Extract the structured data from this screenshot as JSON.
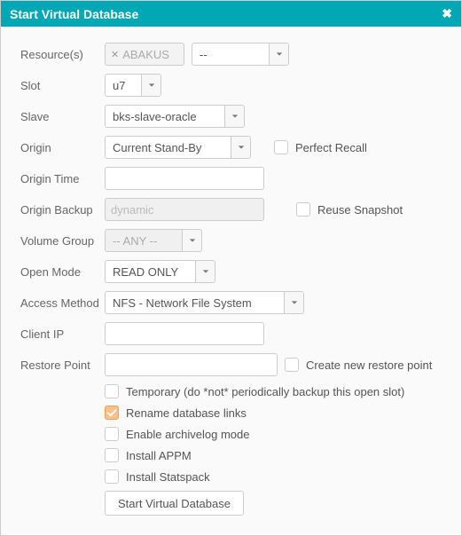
{
  "title": "Start Virtual Database",
  "labels": {
    "resources": "Resource(s)",
    "slot": "Slot",
    "slave": "Slave",
    "origin": "Origin",
    "origin_time": "Origin Time",
    "origin_backup": "Origin Backup",
    "volume_group": "Volume Group",
    "open_mode": "Open Mode",
    "access_method": "Access Method",
    "client_ip": "Client IP",
    "restore_point": "Restore Point"
  },
  "values": {
    "resource_tag": "ABAKUS",
    "resource_select": "--",
    "slot": "u7",
    "slave": "bks-slave-oracle",
    "origin": "Current Stand-By",
    "origin_time": "",
    "origin_backup_placeholder": "dynamic",
    "volume_group": "-- ANY --",
    "open_mode": "READ ONLY",
    "access_method": "NFS - Network File System",
    "client_ip": "",
    "restore_point": ""
  },
  "checkboxes": {
    "perfect_recall": {
      "label": "Perfect Recall",
      "checked": false
    },
    "reuse_snapshot": {
      "label": "Reuse Snapshot",
      "checked": false
    },
    "create_restore_point": {
      "label": "Create new restore point",
      "checked": false
    },
    "temporary": {
      "label": "Temporary (do *not* periodically backup this open slot)",
      "checked": false
    },
    "rename_links": {
      "label": "Rename database links",
      "checked": true
    },
    "archivelog": {
      "label": "Enable archivelog mode",
      "checked": false
    },
    "install_appm": {
      "label": "Install APPM",
      "checked": false
    },
    "install_statspack": {
      "label": "Install Statspack",
      "checked": false
    }
  },
  "button": "Start Virtual Database"
}
